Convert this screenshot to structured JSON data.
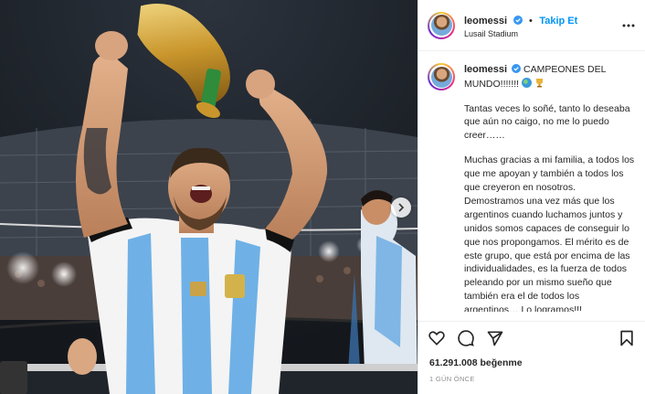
{
  "post": {
    "username": "leomessi",
    "follow_label": "Takip Et",
    "separator": "•",
    "location": "Lusail Stadium",
    "caption_title": "CAMPEONES DEL MUNDO!!!!!!!",
    "caption_paragraphs": [
      "Tantas veces lo soñé, tanto lo deseaba que aún no caigo, no me lo puedo creer……",
      "Muchas gracias a mi familia, a todos los que me apoyan y también a todos los que creyeron en nosotros. Demostramos una vez más que los argentinos cuando luchamos juntos y unidos somos capaces de conseguir lo que nos propongamos. El mérito es de este grupo, que está por encima de las individualidades, es la fuerza de todos peleando por un mismo sueño que también era el de todos los argentinos… Lo logramos!!!"
    ],
    "likes_count": "61.291.008",
    "likes_label": "beğenme",
    "date": "1 GÜN ÖNCE"
  },
  "icons": {
    "verified": "verified-badge-icon",
    "more": "more-options-icon",
    "like": "heart-icon",
    "comment": "comment-icon",
    "share": "share-icon",
    "save": "bookmark-icon",
    "next": "chevron-right-icon"
  },
  "colors": {
    "accent": "#0095f6",
    "verified": "#3897f0",
    "text": "#262626",
    "muted": "#8e8e8e"
  }
}
